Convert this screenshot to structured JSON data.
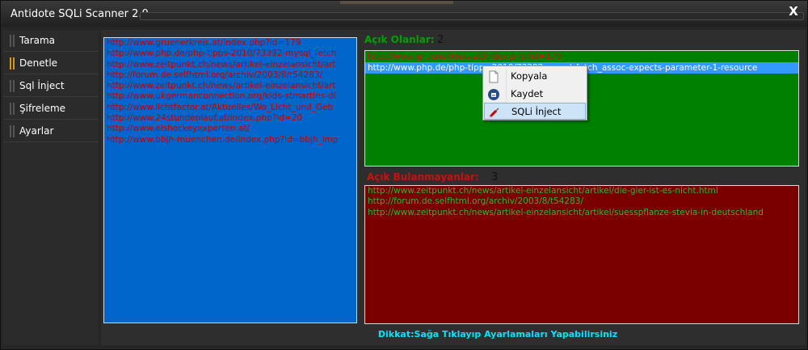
{
  "window": {
    "title": "Antidote SQLi Scanner 2.0",
    "close_label": "X"
  },
  "sidebar": {
    "items": [
      {
        "label": "Tarama",
        "active": false
      },
      {
        "label": "Denetle",
        "active": true
      },
      {
        "label": "Sql İnject",
        "active": false
      },
      {
        "label": "Şifreleme",
        "active": false
      },
      {
        "label": "Ayarlar",
        "active": false
      }
    ]
  },
  "url_list": [
    "http://www.gruenerkreis.at/index.php?id=179",
    "http://www.php.de/php-tipps-2010/73392-mysql_fetch",
    "http://www.zeitpunkt.ch/news/artikel-einzelansicht/art",
    "http://forum.de.selfhtml.org/archiv/2003/8/t54283/",
    "http://www.zeitpunkt.ch/news/artikel-einzelansicht/art",
    "http://www.ukgermanconnection.org/kids-stmartins-di",
    "http://www.lichtfactor.at/Aktuelles/Wo_Licht_und_Geb",
    "http://www.24stundenlauf.at/index.php?id=20",
    "http://www.eishockeyexperten.at/",
    "http://www.bbjh-muenchen.de/index.php?id=bbjh_imp"
  ],
  "open": {
    "label": "Açık Olanlar:",
    "count": "2",
    "items": [
      "http://www.gruenerkreis.at/index.php?id=179",
      "http://www.php.de/php-tipps-2010/73392-mysql_fetch_assoc-expects-parameter-1-resource"
    ]
  },
  "closed": {
    "label": "Açık Bulanmayanlar:",
    "count": "3",
    "items": [
      "http://www.zeitpunkt.ch/news/artikel-einzelansicht/artikel/die-gier-ist-es-nicht.html",
      "http://forum.de.selfhtml.org/archiv/2003/8/t54283/",
      "http://www.zeitpunkt.ch/news/artikel-einzelansicht/artikel/suesspflanze-stevia-in-deutschland"
    ]
  },
  "context_menu": {
    "items": [
      {
        "label": "Kopyala",
        "icon": "document-icon"
      },
      {
        "label": "Kaydet",
        "icon": "save-icon"
      },
      {
        "label": "SQLi İnject",
        "icon": "syringe-icon"
      }
    ]
  },
  "hint": "Dikkat:Sağa Tıklayıp Ayarlamaları Yapabilirsiniz",
  "colors": {
    "url_panel": "#0066cc",
    "open_panel": "#008000",
    "closed_panel": "#7a0000",
    "accent": "#d49a1e",
    "hint": "#00e5ff"
  }
}
